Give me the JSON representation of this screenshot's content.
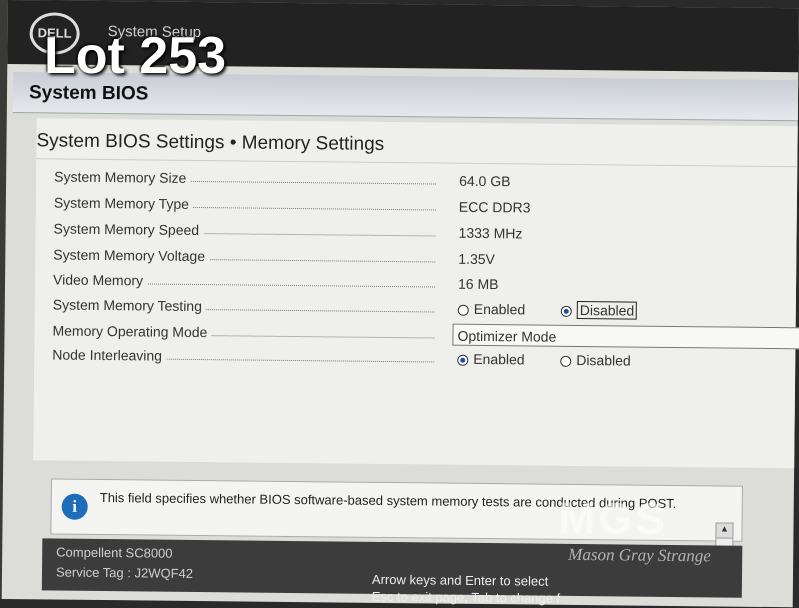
{
  "topbar": {
    "logo_text": "DELL",
    "title": "System Setup"
  },
  "overlay": {
    "lot_label": "Lot 253"
  },
  "section": {
    "title": "System BIOS"
  },
  "content": {
    "title": "System BIOS Settings • Memory Settings",
    "rows": [
      {
        "label": "System Memory Size",
        "value": "64.0 GB"
      },
      {
        "label": "System Memory Type",
        "value": "ECC DDR3"
      },
      {
        "label": "System Memory Speed",
        "value": "1333 MHz"
      },
      {
        "label": "System Memory Voltage",
        "value": "1.35V"
      },
      {
        "label": "Video Memory",
        "value": "16 MB"
      }
    ],
    "memory_testing": {
      "label": "System Memory Testing",
      "option_enabled": "Enabled",
      "option_disabled": "Disabled",
      "selected": "Disabled"
    },
    "operating_mode": {
      "label": "Memory Operating Mode",
      "value": "Optimizer Mode"
    },
    "node_interleaving": {
      "label": "Node Interleaving",
      "option_enabled": "Enabled",
      "option_disabled": "Disabled",
      "selected": "Enabled"
    }
  },
  "help": {
    "icon": "info-icon",
    "icon_glyph": "i",
    "text": "This field specifies whether BIOS software-based system memory tests are conducted during POST."
  },
  "footer": {
    "model": "Compellent SC8000",
    "service_tag": "Service Tag : J2WQF42",
    "hint_line1": "Arrow keys and Enter to select",
    "hint_line2": "Esc to exit page, Tab to change f"
  },
  "watermark": {
    "logo": "MGS",
    "text": "Mason Gray Strange"
  },
  "colors": {
    "topbar": "#222222",
    "accent_blue": "#1d6db8",
    "screen_bg": "#efefed"
  }
}
